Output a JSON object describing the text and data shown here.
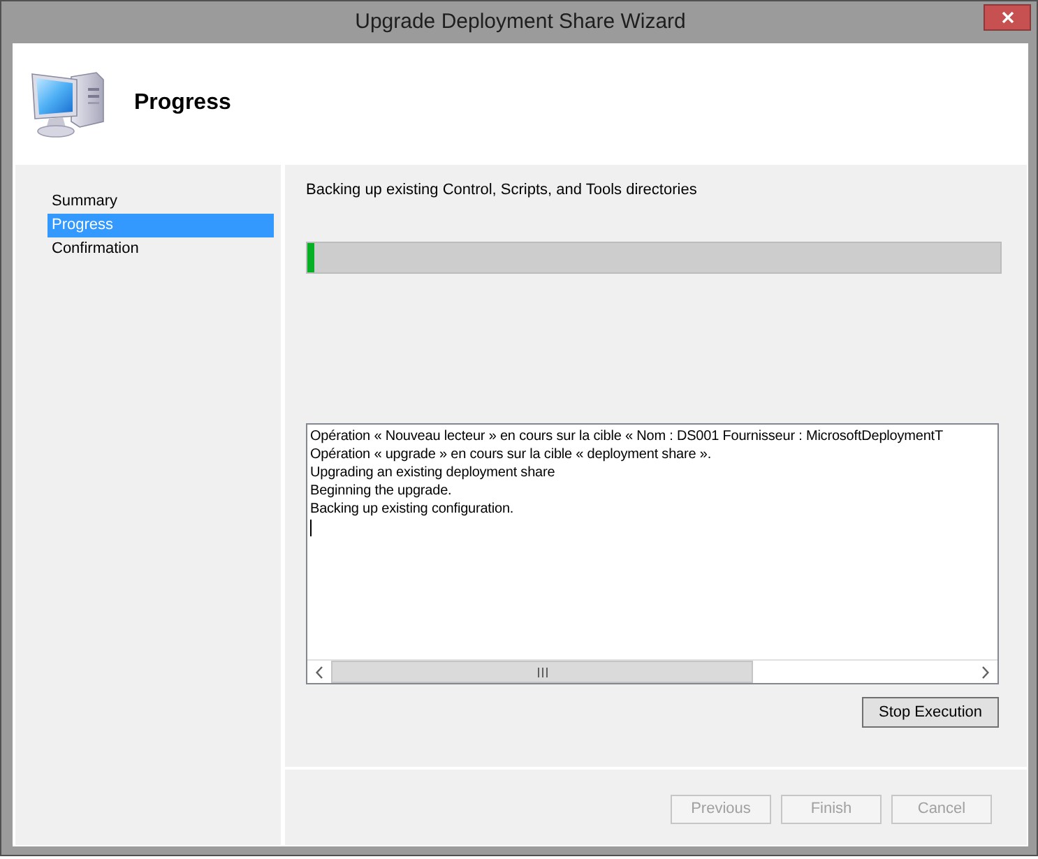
{
  "window": {
    "title": "Upgrade Deployment Share Wizard"
  },
  "header": {
    "title": "Progress"
  },
  "sidebar": {
    "items": [
      {
        "label": "Summary",
        "selected": false
      },
      {
        "label": "Progress",
        "selected": true
      },
      {
        "label": "Confirmation",
        "selected": false
      }
    ]
  },
  "status": {
    "text": "Backing up existing Control, Scripts, and Tools directories"
  },
  "progress": {
    "level": 0.01
  },
  "log": {
    "lines": [
      "Opération « Nouveau lecteur » en cours sur la cible « Nom : DS001 Fournisseur : MicrosoftDeploymentT",
      "Opération « upgrade » en cours sur la cible « deployment share ».",
      "Upgrading an existing deployment share",
      "Beginning the upgrade.",
      "Backing up existing configuration."
    ]
  },
  "stop_button": {
    "label": "Stop Execution",
    "disabled": false
  },
  "buttons": [
    {
      "label": "Previous",
      "disabled": true
    },
    {
      "label": "Finish",
      "disabled": true
    },
    {
      "label": "Cancel",
      "disabled": true
    }
  ]
}
